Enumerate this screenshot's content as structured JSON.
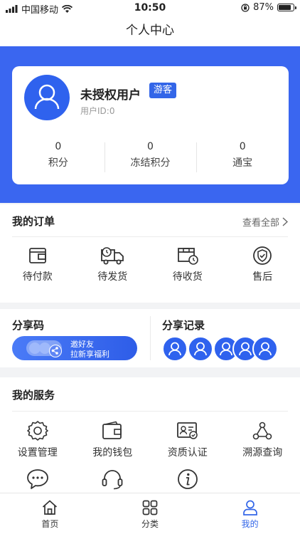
{
  "status_bar": {
    "carrier": "中国移动",
    "time": "10:50",
    "battery_text": "87%",
    "battery_level": 0.87
  },
  "nav": {
    "title": "个人中心"
  },
  "profile": {
    "name": "未授权用户",
    "badge": "游客",
    "user_id": "用户ID:0",
    "stats": [
      {
        "value": "0",
        "label": "积分"
      },
      {
        "value": "0",
        "label": "冻结积分"
      },
      {
        "value": "0",
        "label": "通宝"
      }
    ]
  },
  "orders": {
    "title": "我的订单",
    "view_all": "查看全部",
    "items": [
      {
        "label": "待付款",
        "icon": "wallet-icon"
      },
      {
        "label": "待发货",
        "icon": "truck-icon"
      },
      {
        "label": "待收货",
        "icon": "receive-box-icon"
      },
      {
        "label": "售后",
        "icon": "shield-check-icon"
      }
    ]
  },
  "share": {
    "code_title": "分享码",
    "invite_line1": "邀好友",
    "invite_line2": "拉新享福利",
    "records_title": "分享记录"
  },
  "services": {
    "title": "我的服务",
    "items": [
      {
        "label": "设置管理",
        "icon": "gear-icon"
      },
      {
        "label": "我的钱包",
        "icon": "wallet-icon"
      },
      {
        "label": "资质认证",
        "icon": "certificate-icon"
      },
      {
        "label": "溯源查询",
        "icon": "trace-network-icon"
      },
      {
        "label": "",
        "icon": "chat-bubble-icon"
      },
      {
        "label": "",
        "icon": "headset-icon"
      },
      {
        "label": "",
        "icon": "info-icon"
      }
    ]
  },
  "tab_bar": {
    "tabs": [
      {
        "label": "首页",
        "icon": "home-icon"
      },
      {
        "label": "分类",
        "icon": "grid-icon"
      },
      {
        "label": "我的",
        "icon": "user-icon"
      }
    ],
    "active": "我的",
    "active_color": "#3366e8"
  },
  "colors": {
    "brand": "#3a66f0",
    "badge": "#3366e8"
  }
}
